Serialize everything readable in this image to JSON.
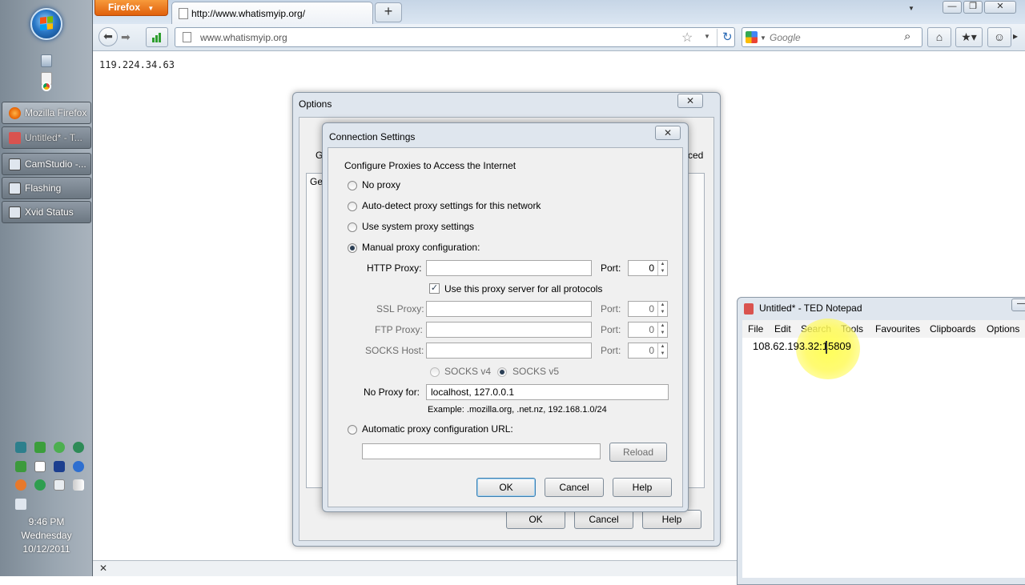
{
  "taskbar": {
    "buttons": [
      {
        "label": "Mozilla Firefox",
        "color": "#e66000"
      },
      {
        "label": "Untitled* - T...",
        "color": "#d9534f"
      },
      {
        "label": "CamStudio -...",
        "color": "#4a6a8a"
      },
      {
        "label": "Flashing",
        "color": "#5a6a7a"
      },
      {
        "label": "Xvid Status",
        "color": "#5a6a7a"
      }
    ],
    "clock": {
      "time": "9:46 PM",
      "day": "Wednesday",
      "date": "10/12/2011"
    }
  },
  "browser": {
    "menu_button": "Firefox",
    "tab_title": "http://www.whatismyip.org/",
    "url": "www.whatismyip.org",
    "search_placeholder": "Google",
    "page_content": "119.224.34.63",
    "accent": "#e66000"
  },
  "options_dialog": {
    "title": "Options",
    "partial_tab_left": "G",
    "partial_tab_right": "ced",
    "inner_tab": "Ger",
    "ok": "OK",
    "cancel": "Cancel",
    "help": "Help"
  },
  "connection_dialog": {
    "title": "Connection Settings",
    "section_title": "Configure Proxies to Access the Internet",
    "options": {
      "no_proxy": "No proxy",
      "auto_detect": "Auto-detect proxy settings for this network",
      "system": "Use system proxy settings",
      "manual": "Manual proxy configuration:",
      "auto_url": "Automatic proxy configuration URL:"
    },
    "selected": "manual",
    "http_label": "HTTP Proxy:",
    "port_label": "Port:",
    "http_port": "0",
    "use_for_all": "Use this proxy server for all protocols",
    "use_for_all_checked": true,
    "ssl_label": "SSL Proxy:",
    "ssl_port": "0",
    "ftp_label": "FTP Proxy:",
    "ftp_port": "0",
    "socks_label": "SOCKS Host:",
    "socks_port": "0",
    "socks_v4": "SOCKS v4",
    "socks_v5": "SOCKS v5",
    "no_proxy_for_label": "No Proxy for:",
    "no_proxy_for_value": "localhost, 127.0.0.1",
    "example": "Example: .mozilla.org, .net.nz, 192.168.1.0/24",
    "reload": "Reload",
    "ok": "OK",
    "cancel": "Cancel",
    "help": "Help"
  },
  "notepad": {
    "title": "Untitled* - TED Notepad",
    "menu": [
      "File",
      "Edit",
      "Search",
      "Tools",
      "Favourites",
      "Clipboards",
      "Options"
    ],
    "content": "108.62.193.32:15809"
  }
}
